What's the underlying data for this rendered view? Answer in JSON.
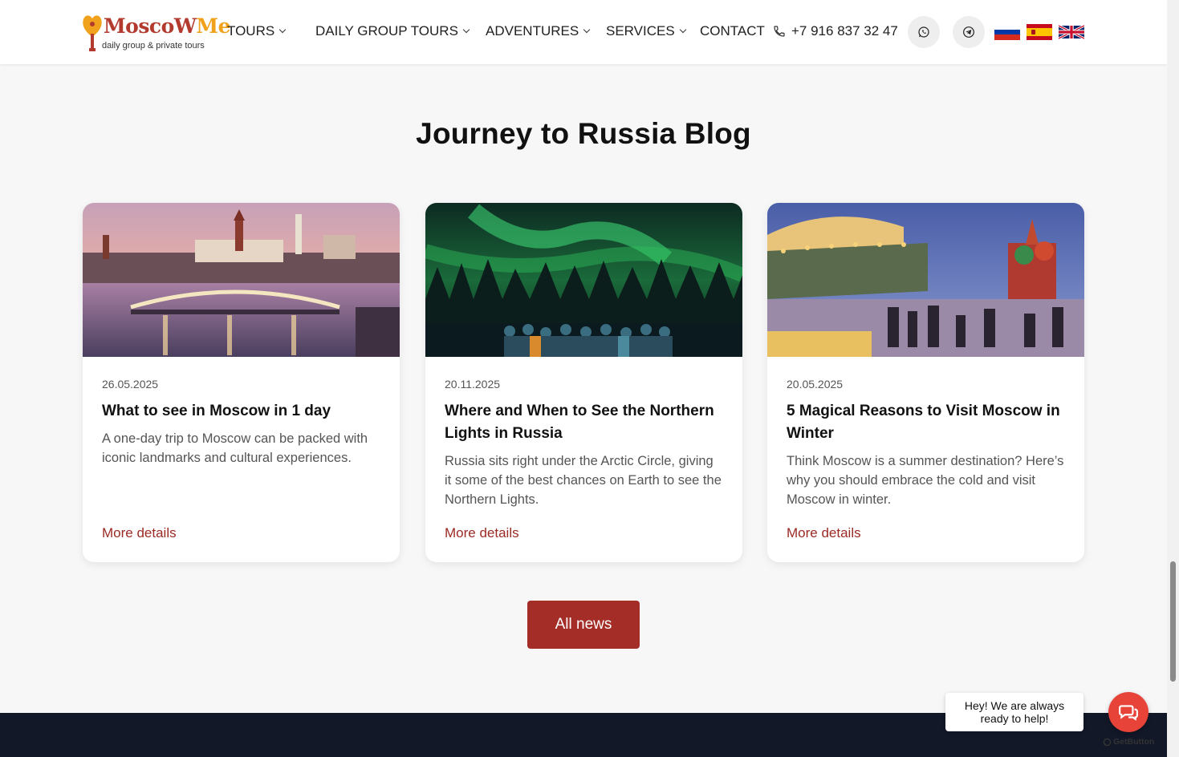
{
  "header": {
    "logo": {
      "word_main": "MoscoW",
      "word_accent": "Me",
      "tagline": "daily group & private tours"
    },
    "nav": [
      {
        "label": "TOURS",
        "dropdown": true
      },
      {
        "label": "DAILY GROUP TOURS",
        "dropdown": true
      },
      {
        "label": "ADVENTURES",
        "dropdown": true
      },
      {
        "label": "SERVICES",
        "dropdown": true
      },
      {
        "label": "CONTACT",
        "dropdown": false
      }
    ],
    "phone": "+7 916 837 32 47",
    "icons": [
      "phone-icon",
      "whatsapp-icon",
      "telegram-icon"
    ],
    "languages": [
      "ru-flag",
      "es-flag",
      "uk-flag"
    ]
  },
  "blog": {
    "title": "Journey to Russia Blog",
    "cards": [
      {
        "date": "26.05.2025",
        "title": "What to see in Moscow in 1 day",
        "text": "A one-day trip to Moscow can be packed with iconic landmarks and cultural experiences.",
        "more": "More details"
      },
      {
        "date": "20.11.2025",
        "title": "Where and When to See the Northern Lights in Russia",
        "text": "Russia sits right under the Arctic Circle, giving it some of the best chances on Earth to see the Northern Lights.",
        "more": "More details"
      },
      {
        "date": "20.05.2025",
        "title": "5 Magical Reasons to Visit Moscow in Winter",
        "text": "Think Moscow is a summer destination? Here’s why you should embrace the cold and visit Moscow in winter.",
        "more": "More details"
      }
    ],
    "all_news": "All news"
  },
  "chat": {
    "line1": "Hey! We are always",
    "line2": "ready to help!",
    "brand": "GetButton"
  },
  "colors": {
    "accent": "#a42e27",
    "link": "#9b2a24",
    "footer": "#121828",
    "chat": "#e74339"
  }
}
